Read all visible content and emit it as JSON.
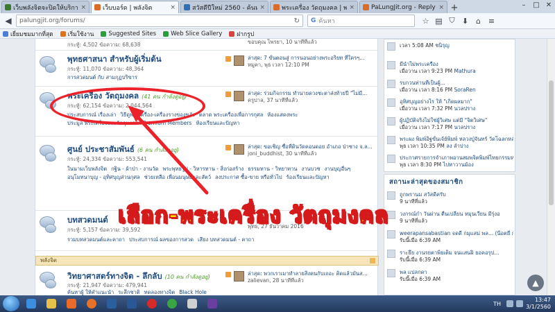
{
  "browser": {
    "tabs": [
      {
        "label": "เว็บพลังจิตจะปิดให้บริการ ตั้ง...",
        "favicon": "#3b7a2f",
        "active": false
      },
      {
        "label": "เว็บบอร์ด | พลังจิต",
        "favicon": "#d96b2b",
        "active": true
      },
      {
        "label": "สวัสดีปีใหม่ 2560 - ค้นหาด้วย...",
        "favicon": "#2f6fb5",
        "active": false
      },
      {
        "label": "พระเครื่อง วัดถุมงคล | พลังจิต",
        "favicon": "#d96b2b",
        "active": false
      },
      {
        "label": "PaLungJit.org - Reply to To...",
        "favicon": "#d96b2b",
        "active": false
      }
    ],
    "url": "palungjit.org/forums/",
    "search_placeholder": "ค้นหา",
    "bookmarks": [
      {
        "label": "เยี่ยมชมมากที่สุด",
        "color": "#4a7fd7"
      },
      {
        "label": "เริ่มใช้งาน",
        "color": "#e2711d"
      },
      {
        "label": "Suggested Sites",
        "color": "#2e9b3f"
      },
      {
        "label": "Web Slice Gallery",
        "color": "#2e9b3f"
      },
      {
        "label": "ฝากรูป",
        "color": "#d6453d"
      }
    ]
  },
  "forums": [
    {
      "title": "",
      "stats": "กระทู้: 4,502 ข้อความ: 68,638",
      "subs": [],
      "last_title": "",
      "last_meta": "ขอบคุณ ไพรยา, 10 นาทีที่แล้ว"
    },
    {
      "title": "พุทธศาสนา สำหรับผู้เริ่มต้น",
      "viewers": "",
      "stats": "กระทู้: 11,070 ข้อความ: 48,364",
      "subs": [
        "การสวดมนต์ กับ สามกุฏบริขาร"
      ],
      "last_title": "ล่าสุด: 7 ขั้นตอนสู่ การนอนอย่างพระอริยท ที่ใครๆ...",
      "last_meta": "หมูคา, พุธ เวลา 12:10 PM"
    },
    {
      "title": "พระเครื่อง วัตถุมงคล",
      "viewers": "(41 คน กำลังดูอยู่)",
      "stats": "กระทู้: 62,154 ข้อความ: 2,044,564",
      "subs": [
        "ประสบการณ์ เรื่องเล่า",
        "วิธีดูพระเครื่อง-เครื่องรางของขลัง",
        "ตลาด พระเครื่องเพื่อการกุศล",
        "ห้องแสดงพระ",
        "ประมูล พระเครื่องและวัตถุมงคล",
        "Premium Members",
        "ห้องเรียนและปัญหา"
      ],
      "last_title": "ล่าสุด: ร่วมกิจกรรม ทำนายดวงชะตาส่งท้ายปี \"ไม่มี...",
      "last_meta": "ครูปาล, 37 นาทีที่แล้ว"
    },
    {
      "title": "ศูนย์ ประชาสัมพันธ์",
      "viewers": "(6 คน กำลังดูอยู่)",
      "stats": "กระทู้: 24,334 ข้อความ: 553,541",
      "subs": [
        "ในนามเว็บพลังจิต",
        "กฐิน - ผ้าป่า - งานวัด",
        "พระพุทธรูป - วิหารทาน - สิ่งก่อสร้าง",
        "ธรรมทาน - วิทยาทาน",
        "งานบวช",
        "งานบุญอื่นๆ",
        "อนุโมทนาบุญ - อุทิศบุญส่วนกุศล",
        "ช่วยเหลือ เพื่อนมนุษย์และสัตว์",
        "ลงประกาศ ซื้อ-ขาย หรือทั่วไป",
        "ร้องเรียนและปัญหา"
      ],
      "last_title": "ล่าสุด: ขอเชิญ ซื้อที่ดินวัดคอนดอย อำเภอ ป่าซาง จ.ล...",
      "last_meta": "joni_buddhist, 30 นาทีที่แล้ว"
    },
    {
      "title": "บทสวดมนต์",
      "viewers": "",
      "stats": "กระทู้: 5,157 ข้อความ: 39,592",
      "subs": [
        "รวมบทสวดมนต์และคาถา",
        "ประสบการณ์ ผลของการสวด",
        "เสียง บทสวดมนต์ - คาถา"
      ],
      "last_title": "",
      "last_meta": "พุทธ, 27 ธันวาคม 2016"
    }
  ],
  "category": {
    "label": "พลังจิต"
  },
  "science_forum": {
    "title": "วิทยาศาสตร์ทางจิต - ลึกลับ",
    "viewers": "(10 คน กำลังดูอยู่)",
    "stats": "กระทู้: 21,947 ข้อความ: 479,941",
    "subs": [
      "ค้นหาผู้ ให้คำแนะนำ",
      "ระลึกชาติ",
      "ทดลองทางจิต",
      "Black Hole"
    ],
    "last_title": "ล่าสุด: พวกเราเมาทำลายสิ่งคนกับเถอะ คิดแล้วมันส...",
    "last_meta": "zalievan, 28 นาทีที่แล้ว"
  },
  "sidebar_recent": [
    {
      "title": "",
      "who": "ชนิรุญ",
      "time": "เวลา 5:08 AM"
    },
    {
      "title": "มีนำไม่พระเครื่อง",
      "who": "Mathura",
      "time": "เมื่อวาน เวลา 9:23 PM"
    },
    {
      "title": "รบกวนท่านที่เป็นผู้...",
      "who": "SoraRen",
      "time": "เมื่อวาน เวลา 8:16 PM"
    },
    {
      "title": "อุทิศบุญอย่างไร ให้ \"เกิดผลมาก\"",
      "who": "นวลปราง",
      "time": "เมื่อวาน เวลา 7:32 PM"
    },
    {
      "title": "ผู้ปฏิบัติจริงไม่ใช่ผู้วิเศษ แต่มี \"จิตวิเศษ\"",
      "who": "นวลปราง",
      "time": "เมื่อวาน เวลา 7:17 PM"
    },
    {
      "title": "พระผง พิมพ์อิฐขั้นเจ้ย์พิมพ์ หลวงปู่จันทร์ วัดโฉลกหลำ เกาะพงัน สุราษฎร์ธานี",
      "who": "ลง ลำปาง",
      "time": "พุธ เวลา 10:35 PM"
    },
    {
      "title": "ประกาศรายการจำเภาพอานสมพจิตพิมพ์ไทยกรรมหนังสือ ล่ะอยสตรีสวรรค์ ขอนแก่น",
      "who": "ไปหาวานม้อง",
      "time": "พุธ เวลา 8:30 PM"
    }
  ],
  "sidebar_status_head": "สถานะล่าสุดของสมาชิก",
  "sidebar_status": [
    {
      "text": "ถูกพรานม สวัสดีครับ",
      "time": "9 นาทีที่แล้ว"
    },
    {
      "text": "วงกรณ์ก๋า วันผ่าน ตื่นเปลี่ยน หมุนเวียน มีรุ่งอ",
      "time": "9 นาทีที่แล้ว"
    },
    {
      "text": "weerapansabastian จดดี กมุแสม่ พล... (น๊อตยี่ กรรม)",
      "time": "รับนี้เมื่อ 6:39 AM"
    },
    {
      "text": "ราะธึย งานรยตาพิ่ยเต็ม จนแสนฝิ ยอคอรุป...",
      "time": "รับนี้เมื่อ 6:39 AM"
    },
    {
      "text": "พล แปลกดา",
      "time": "รับนี้เมื่อ 6:39 AM"
    }
  ],
  "annotation": {
    "text": "เลือก-พระเครื่อง วัตถุมงคล",
    "color": "#ec2129",
    "text_color": "#ffe600"
  },
  "taskbar": {
    "lang": "TH",
    "time": "13:47",
    "date": "3/1/2560"
  },
  "colors": {
    "link": "#204c7f",
    "viewers": "#4d9e28",
    "accent_red": "#ec2129"
  }
}
